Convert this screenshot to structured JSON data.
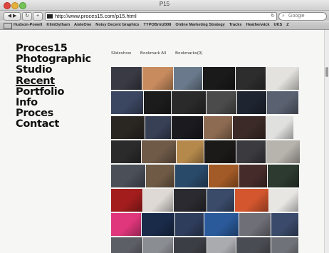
{
  "window": {
    "title": "P15"
  },
  "toolbar": {
    "back_label": "◀ ▶",
    "reload_label": "↻",
    "add_label": "+",
    "url": "http://www.proces15.com/p15.html",
    "search_placeholder": "Google"
  },
  "bookmarks": [
    "Hudson-Powell",
    "KlimDytham",
    "AisleOne",
    "Noisy Decent Graphics",
    "TYPOBrin2008",
    "Online Marketing Strategy",
    "Tracks",
    "Heatherwick",
    "UKS",
    "Z"
  ],
  "nav": {
    "logo_line1": "Proces15",
    "logo_line2": "Photographic",
    "logo_line3": "Studio",
    "items": [
      "Recent",
      "Portfolio",
      "Info",
      "Proces",
      "Contact"
    ]
  },
  "submenu": [
    "Slideshow",
    "Bookmark All",
    "Bookmarks(0)"
  ],
  "colors": {
    "page_bg": "#f6f6f4",
    "text": "#111111"
  },
  "gallery": [
    [
      "#3a3a44",
      "#c78b5e",
      "#6a7a8c",
      "#1a1a1a",
      "#2d2d2d",
      "#e4e2de"
    ],
    [
      "#3b4660",
      "#1c1c1c",
      "#2a2a2a",
      "#4b4b4b",
      "#1e2430",
      "#5a6170"
    ],
    [
      "#2a2622",
      "#384056",
      "#1a1a1f",
      "#8d6b52",
      "#3b2a27",
      "#e0e0de"
    ],
    [
      "#2b2b2b",
      "#6f5a48",
      "#b5894c",
      "#1c1a19",
      "#3a3a3f",
      "#b7b3ad"
    ],
    [
      "#4b4f58",
      "#6f5a45",
      "#2a4a6a",
      "#a25a26",
      "#452c2a",
      "#2c3a2f"
    ],
    [
      "#a31d1d",
      "#ded9d5",
      "#2a2a30",
      "#3a4b6a",
      "#d3562e",
      "#e8e6e3"
    ],
    [
      "#e0377c",
      "#1a2b4a",
      "#2f3d5c",
      "#2a5a9a",
      "#6f6f78",
      "#3a4a6a"
    ],
    [
      "#5c5f66",
      "#8a8d92",
      "#3b3e44",
      "#a9abaf",
      "#494c52",
      "#6f7278"
    ]
  ]
}
